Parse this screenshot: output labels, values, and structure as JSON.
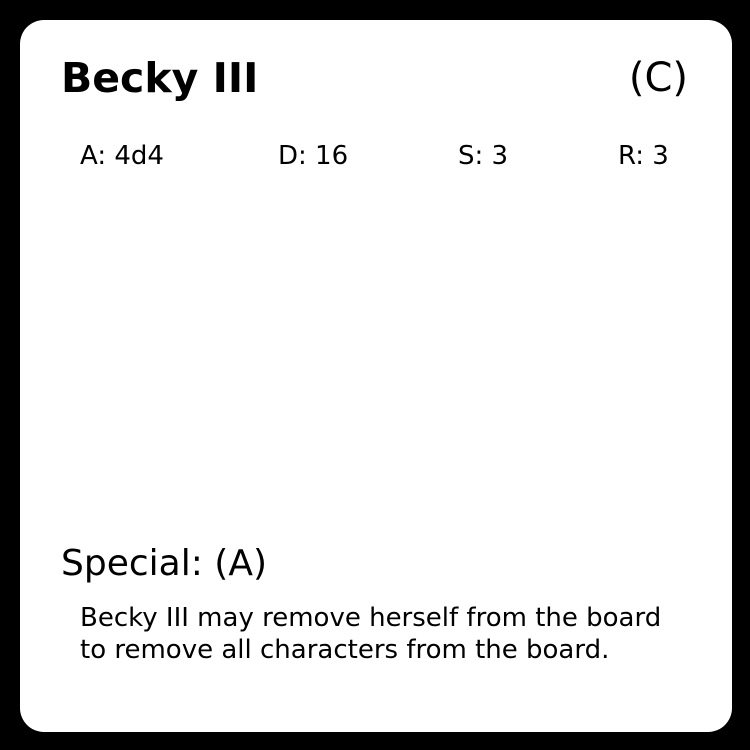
{
  "card": {
    "name": "Becky III",
    "rarity": "(C)",
    "stats": {
      "attack": "A: 4d4",
      "defense": "D: 16",
      "speed": "S: 3",
      "range": "R: 3"
    },
    "special": {
      "heading": "Special: (A)",
      "text": "Becky III may remove herself from the board to remove all characters from the board."
    }
  },
  "colors": {
    "background": "#000000",
    "card": "#ffffff",
    "text": "#000000"
  }
}
